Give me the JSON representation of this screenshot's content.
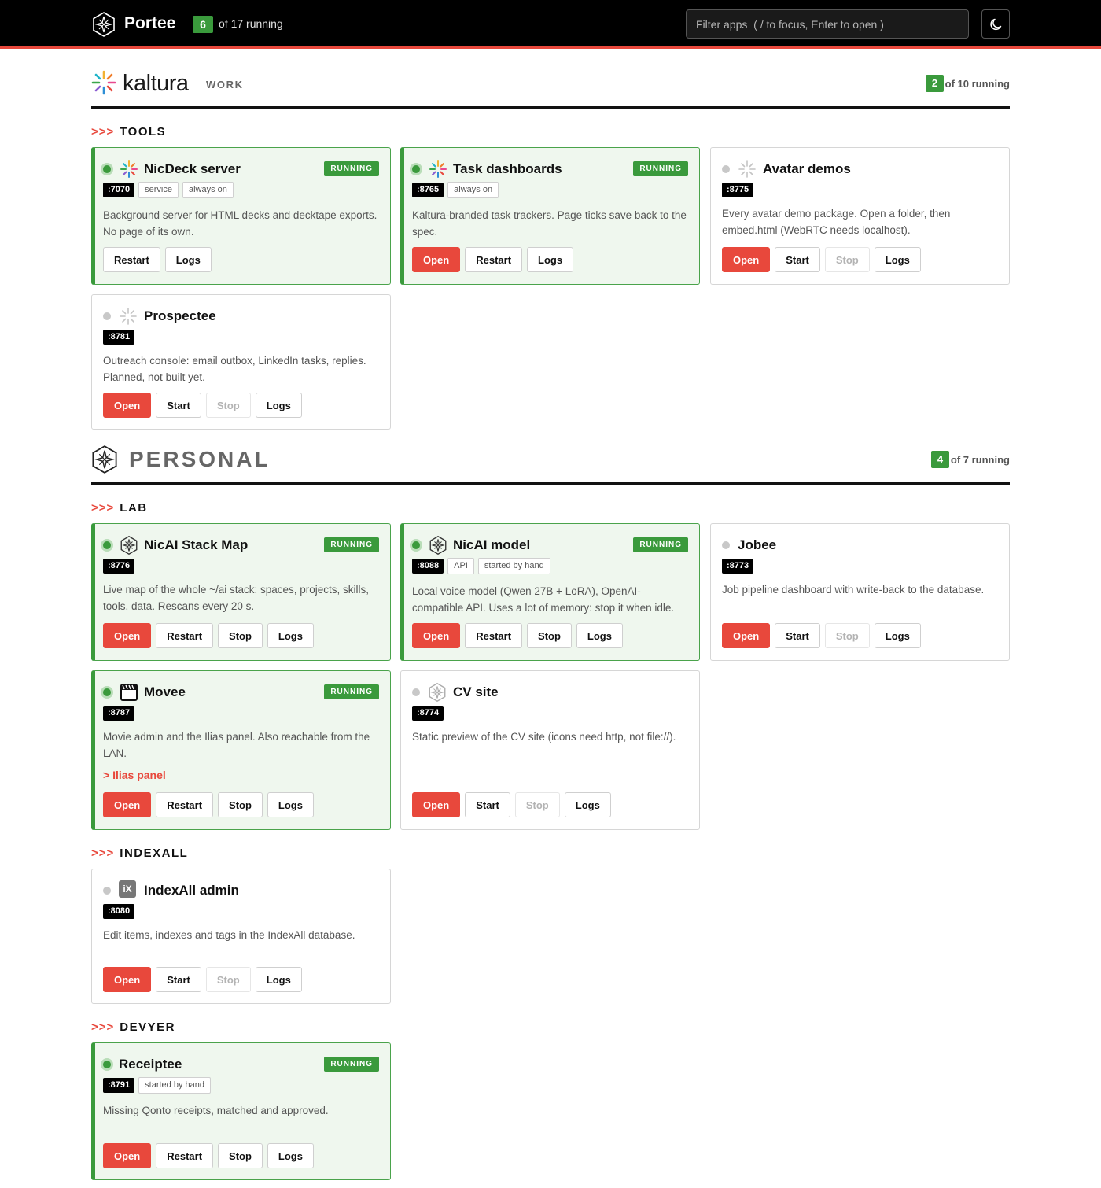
{
  "header": {
    "brand": "Portee",
    "running_count": "6",
    "running_label": "of 17 running",
    "filter_placeholder": "Filter apps  ( / to focus, Enter to open )",
    "theme_icon": "moon-icon"
  },
  "orgs": {
    "work": {
      "name": "kaltura",
      "tag": "WORK",
      "running_count": "2",
      "running_label": "of 10 running"
    },
    "personal": {
      "name": "PERSONAL",
      "running_count": "4",
      "running_label": "of 7 running"
    }
  },
  "sections": {
    "tools": {
      "arrows": ">>>",
      "label": "TOOLS"
    },
    "lab": {
      "arrows": ">>>",
      "label": "LAB"
    },
    "indexall": {
      "arrows": ">>>",
      "label": "INDEXALL"
    },
    "devyer": {
      "arrows": ">>>",
      "label": "DEVYER"
    }
  },
  "status": {
    "running": "RUNNING"
  },
  "buttons": {
    "open": "Open",
    "start": "Start",
    "stop": "Stop",
    "restart": "Restart",
    "logs": "Logs"
  },
  "apps": {
    "nicdeck": {
      "title": "NicDeck server",
      "port": ":7070",
      "tags": [
        "service",
        "always on"
      ],
      "description": "Background server for HTML decks and decktape exports. No page of its own.",
      "icon": "kaltura-icon"
    },
    "taskdash": {
      "title": "Task dashboards",
      "port": ":8765",
      "tags": [
        "always on"
      ],
      "description": "Kaltura-branded task trackers. Page ticks save back to the spec.",
      "icon": "kaltura-icon"
    },
    "avatar": {
      "title": "Avatar demos",
      "port": ":8775",
      "description": "Every avatar demo package. Open a folder, then embed.html (WebRTC needs localhost).",
      "icon": "kaltura-grey-icon"
    },
    "prospectee": {
      "title": "Prospectee",
      "port": ":8781",
      "description": "Outreach console: email outbox, LinkedIn tasks, replies. Planned, not built yet.",
      "icon": "kaltura-grey-icon"
    },
    "stackmap": {
      "title": "NicAI Stack Map",
      "port": ":8776",
      "description": "Live map of the whole ~/ai stack: spaces, projects, skills, tools, data. Rescans every 20 s.",
      "icon": "compass-emblem-icon"
    },
    "model": {
      "title": "NicAI model",
      "port": ":8088",
      "tags": [
        "API",
        "started by hand"
      ],
      "description": "Local voice model (Qwen 27B + LoRA), OpenAI-compatible API. Uses a lot of memory: stop it when idle.",
      "icon": "compass-emblem-icon"
    },
    "jobee": {
      "title": "Jobee",
      "port": ":8773",
      "description": "Job pipeline dashboard with write-back to the database."
    },
    "movee": {
      "title": "Movee",
      "port": ":8787",
      "description": "Movie admin and the Ilias panel. Also reachable from the LAN.",
      "link": "> Ilias panel",
      "icon": "clapperboard-icon"
    },
    "cvsite": {
      "title": "CV site",
      "port": ":8774",
      "description": "Static preview of the CV site (icons need http, not file://).",
      "icon": "compass-emblem-grey-icon"
    },
    "indexall": {
      "title": "IndexAll admin",
      "port": ":8080",
      "description": "Edit items, indexes and tags in the IndexAll database.",
      "icon": "ix-icon",
      "icon_text": "iX"
    },
    "receiptee": {
      "title": "Receiptee",
      "port": ":8791",
      "tags": [
        "started by hand"
      ],
      "description": "Missing Qonto receipts, matched and approved."
    }
  },
  "colors": {
    "accent": "#e8483c",
    "running_green": "#3a9a3c",
    "running_bg": "#eff7ee",
    "topbar": "#000000"
  }
}
